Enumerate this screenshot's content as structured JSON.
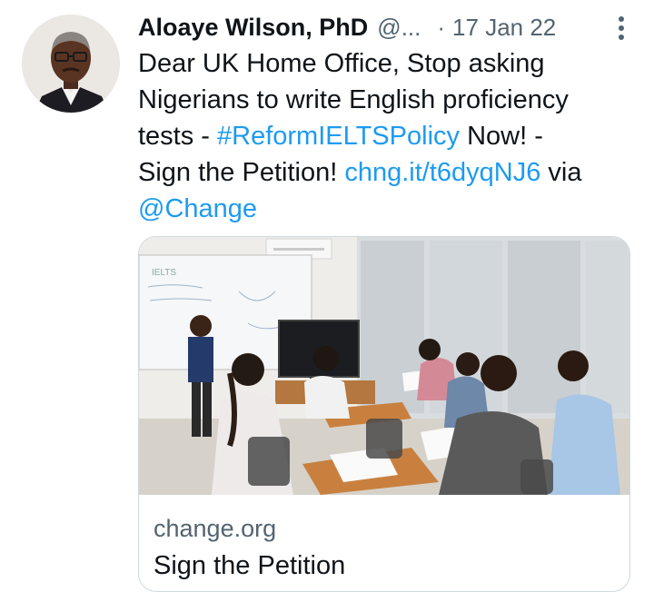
{
  "tweet": {
    "author_name": "Aloaye Wilson, PhD",
    "handle": "@...",
    "separator": "·",
    "date": "17 Jan 22",
    "text": {
      "l1": "Dear UK Home Office, Stop asking",
      "l2": "Nigerians to write English proficiency",
      "l3a": "tests - ",
      "hashtag": "#ReformIELTSPolicy",
      "l3b": " Now! -",
      "l4a": "Sign the Petition! ",
      "short_link": "chng.it/t6dyqNJ6",
      "l4b": " via",
      "mention": "@Change"
    },
    "link_color": "#1d9bf0"
  },
  "card": {
    "domain": "change.org",
    "title": "Sign the Petition",
    "whiteboard_text": "IELTS"
  },
  "icons": {
    "more": "more-vertical-icon",
    "avatar": "profile-photo"
  }
}
